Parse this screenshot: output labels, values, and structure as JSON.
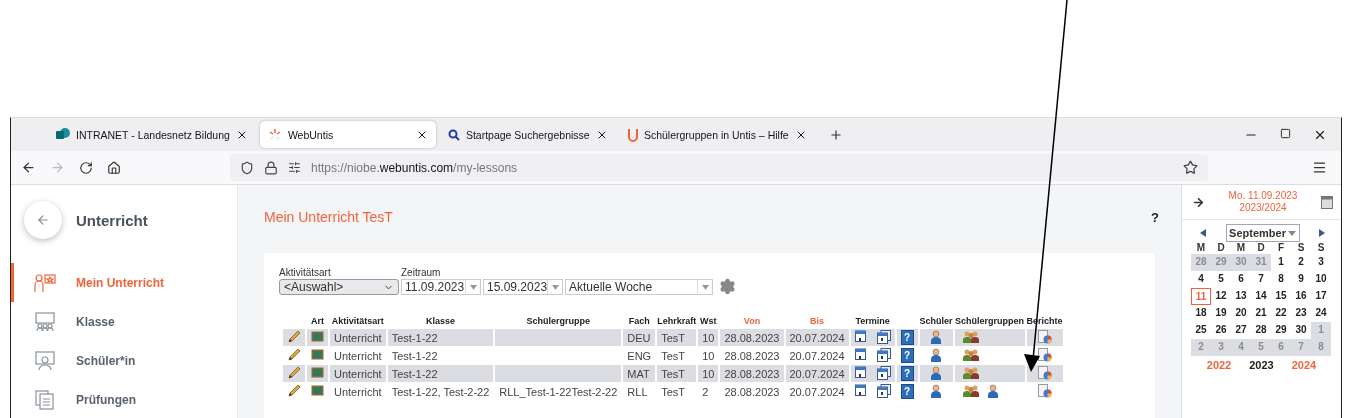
{
  "browser": {
    "tabs": [
      {
        "label": "INTRANET - Landesnetz Bildung",
        "kind": "sharepoint",
        "selected": false
      },
      {
        "label": "WebUntis",
        "kind": "webuntis",
        "selected": true
      },
      {
        "label": "Startpage Suchergebnisse",
        "kind": "search",
        "selected": false
      },
      {
        "label": "Schülergruppen in Untis – Hilfe",
        "kind": "untis",
        "selected": false
      }
    ],
    "url": {
      "host": "https://niobe.",
      "domain": "webuntis.com",
      "path": "/my-lessons"
    }
  },
  "sidebar": {
    "title": "Unterricht",
    "items": [
      {
        "label": "Mein Unterricht",
        "kind": "lessons",
        "selected": true
      },
      {
        "label": "Klasse",
        "kind": "class",
        "selected": false
      },
      {
        "label": "Schüler*in",
        "kind": "student",
        "selected": false
      },
      {
        "label": "Prüfungen",
        "kind": "exams",
        "selected": false
      }
    ]
  },
  "main": {
    "title": "Mein Unterricht TesT",
    "help": "?",
    "filters": {
      "activity_label": "Aktivitätsart",
      "activity_value": "<Auswahl>",
      "period_label": "Zeitraum",
      "date_from": "11.09.2023",
      "date_to": "15.09.2023",
      "range": "Aktuelle Woche"
    },
    "table": {
      "columns": [
        {
          "kind": "edit"
        },
        {
          "kind": "type",
          "label": "Art"
        },
        {
          "kind": "text",
          "label": "Aktivitätsart",
          "highlight": false
        },
        {
          "kind": "text",
          "label": "Klasse",
          "highlight": false
        },
        {
          "kind": "text",
          "label": "Schülergruppe",
          "highlight": false
        },
        {
          "kind": "text",
          "label": "Fach",
          "highlight": false
        },
        {
          "kind": "text",
          "label": "Lehrkraft",
          "highlight": false
        },
        {
          "kind": "text",
          "label": "Wst",
          "highlight": false
        },
        {
          "kind": "text",
          "label": "Von",
          "highlight": true
        },
        {
          "kind": "text",
          "label": "Bis",
          "highlight": true
        },
        {
          "kind": "appointments",
          "label": "Termine"
        },
        {
          "kind": "help"
        },
        {
          "kind": "student",
          "label": "Schüler"
        },
        {
          "kind": "groups",
          "label": "Schülergruppen"
        },
        {
          "kind": "reports",
          "label": "Berichte"
        }
      ],
      "rows": [
        {
          "shaded": true,
          "activity": "Unterricht",
          "class": "Test-1-22",
          "subject": "DEU",
          "teacher": "TesT",
          "hours": "10",
          "from": "28.08.2023",
          "to": "20.07.2024",
          "help": "?",
          "group_member": false
        },
        {
          "shaded": false,
          "activity": "Unterricht",
          "class": "Test-1-22",
          "subject": "ENG",
          "teacher": "TesT",
          "hours": "10",
          "from": "28.08.2023",
          "to": "20.07.2024",
          "help": "?",
          "group_member": false
        },
        {
          "shaded": true,
          "activity": "Unterricht",
          "class": "Test-1-22",
          "subject": "MAT",
          "teacher": "TesT",
          "hours": "10",
          "from": "28.08.2023",
          "to": "20.07.2024",
          "help": "?",
          "group_member": false
        },
        {
          "shaded": false,
          "activity": "Unterricht",
          "class": "Test-1-22, Test-2-22",
          "group": "RLL_Test-1-22Test-2-22",
          "subject": "RLL",
          "teacher": "TesT",
          "hours": "2",
          "from": "28.08.2023",
          "to": "20.07.2024",
          "help": "?",
          "group_member": true
        }
      ]
    }
  },
  "calendar": {
    "date": "Mo. 11.09.2023",
    "school_year": "2023/2024",
    "month": "September",
    "weekdays": [
      "M",
      "D",
      "M",
      "D",
      "F",
      "S",
      "S"
    ],
    "weeks": [
      {
        "days": [
          {
            "d": "28",
            "outside": true,
            "selected": false
          },
          {
            "d": "29",
            "outside": true,
            "selected": false
          },
          {
            "d": "30",
            "outside": true,
            "selected": false
          },
          {
            "d": "31",
            "outside": true,
            "selected": false
          },
          {
            "d": "1",
            "outside": false,
            "selected": false
          },
          {
            "d": "2",
            "outside": false,
            "selected": false
          },
          {
            "d": "3",
            "outside": false,
            "selected": false
          }
        ]
      },
      {
        "days": [
          {
            "d": "4",
            "outside": false,
            "selected": false
          },
          {
            "d": "5",
            "outside": false,
            "selected": false
          },
          {
            "d": "6",
            "outside": false,
            "selected": false
          },
          {
            "d": "7",
            "outside": false,
            "selected": false
          },
          {
            "d": "8",
            "outside": false,
            "selected": false
          },
          {
            "d": "9",
            "outside": false,
            "selected": false
          },
          {
            "d": "10",
            "outside": false,
            "selected": false
          }
        ]
      },
      {
        "days": [
          {
            "d": "11",
            "outside": false,
            "selected": true
          },
          {
            "d": "12",
            "outside": false,
            "selected": false
          },
          {
            "d": "13",
            "outside": false,
            "selected": false
          },
          {
            "d": "14",
            "outside": false,
            "selected": false
          },
          {
            "d": "15",
            "outside": false,
            "selected": false
          },
          {
            "d": "16",
            "outside": false,
            "selected": false
          },
          {
            "d": "17",
            "outside": false,
            "selected": false
          }
        ]
      },
      {
        "days": [
          {
            "d": "18",
            "outside": false,
            "selected": false
          },
          {
            "d": "19",
            "outside": false,
            "selected": false
          },
          {
            "d": "20",
            "outside": false,
            "selected": false
          },
          {
            "d": "21",
            "outside": false,
            "selected": false
          },
          {
            "d": "22",
            "outside": false,
            "selected": false
          },
          {
            "d": "23",
            "outside": false,
            "selected": false
          },
          {
            "d": "24",
            "outside": false,
            "selected": false
          }
        ]
      },
      {
        "days": [
          {
            "d": "25",
            "outside": false,
            "selected": false
          },
          {
            "d": "26",
            "outside": false,
            "selected": false
          },
          {
            "d": "27",
            "outside": false,
            "selected": false
          },
          {
            "d": "28",
            "outside": false,
            "selected": false
          },
          {
            "d": "29",
            "outside": false,
            "selected": false
          },
          {
            "d": "30",
            "outside": false,
            "selected": false
          },
          {
            "d": "1",
            "outside": true,
            "selected": false
          }
        ]
      },
      {
        "days": [
          {
            "d": "2",
            "outside": true,
            "selected": false
          },
          {
            "d": "3",
            "outside": true,
            "selected": false
          },
          {
            "d": "4",
            "outside": true,
            "selected": false
          },
          {
            "d": "5",
            "outside": true,
            "selected": false
          },
          {
            "d": "6",
            "outside": true,
            "selected": false
          },
          {
            "d": "7",
            "outside": true,
            "selected": false
          },
          {
            "d": "8",
            "outside": true,
            "selected": false
          }
        ]
      }
    ],
    "years": [
      {
        "label": "2022",
        "current": false
      },
      {
        "label": "2023",
        "current": true
      },
      {
        "label": "2024",
        "current": false
      }
    ]
  }
}
